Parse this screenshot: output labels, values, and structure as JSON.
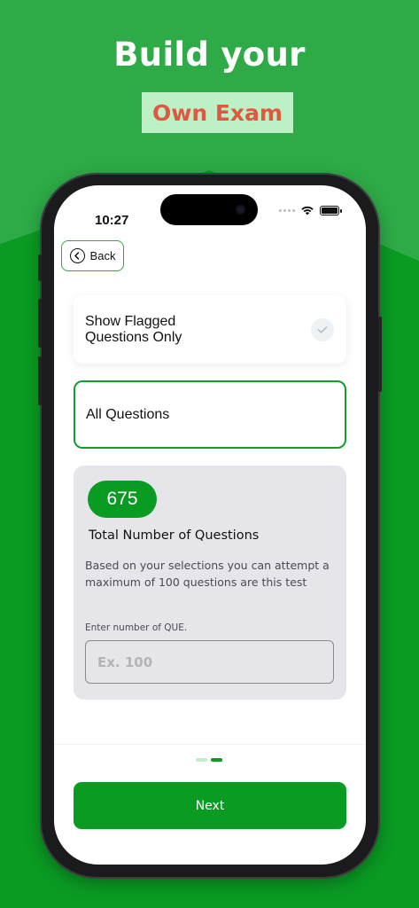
{
  "promo": {
    "headline": "Build your",
    "highlight": "Own Exam"
  },
  "status_bar": {
    "time": "10:27"
  },
  "nav": {
    "back_label": "Back"
  },
  "options": {
    "flagged_label": "Show Flagged Questions Only",
    "all_label": "All Questions"
  },
  "summary": {
    "count": "675",
    "title": "Total Number of Questions",
    "description": "Based on your selections you can attempt a maximum of 100 questions are this test",
    "input_label": "Enter number of QUE.",
    "input_placeholder": "Ex. 100",
    "input_value": ""
  },
  "pager": {
    "pages": 2,
    "active_index": 1
  },
  "footer": {
    "next_label": "Next"
  },
  "colors": {
    "brand_green": "#0a9b23",
    "light_green": "#2eab47",
    "highlight_bg": "#bdf0c4",
    "highlight_text": "#e0583f"
  }
}
